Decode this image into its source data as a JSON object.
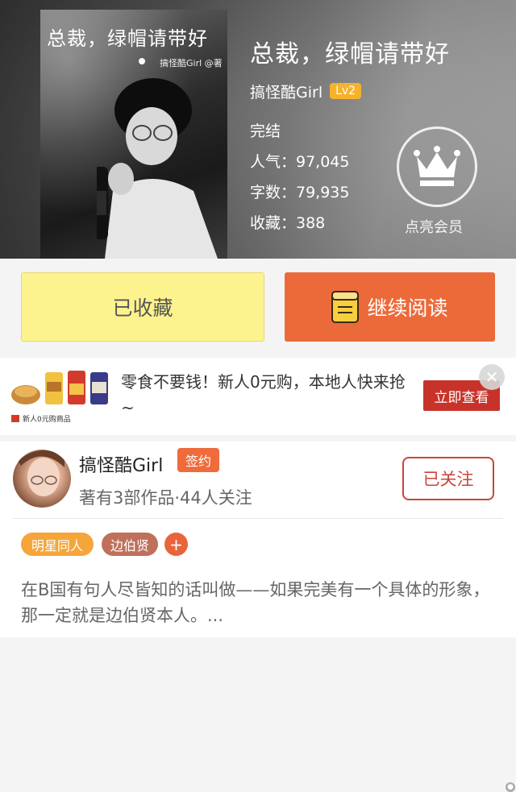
{
  "book": {
    "cover_title": "总裁，绿帽请带好",
    "cover_author": "搞怪酷Girl @著",
    "title": "总裁，绿帽请带好",
    "author": "搞怪酷Girl",
    "level": "Lv2",
    "status": "完结",
    "popularity": "人气：97,045",
    "word_count": "字数：79,935",
    "favorites": "收藏：388"
  },
  "vip": {
    "label": "点亮会员",
    "icon": "crown-icon"
  },
  "actions": {
    "favorited_label": "已收藏",
    "continue_label": "继续阅读",
    "continue_icon": "book-icon"
  },
  "ad": {
    "text": "零食不要钱！新人0元购，本地人快来抢~",
    "button_label": "立即查看",
    "image_caption": "新人0元购商品",
    "close_icon": "close-icon"
  },
  "author_card": {
    "name": "搞怪酷Girl",
    "badge": "签约",
    "meta": "著有3部作品·44人关注",
    "follow_label": "已关注",
    "tags": [
      "明星同人",
      "边伯贤"
    ],
    "add_tag": "+",
    "summary": "在B国有句人尽皆知的话叫做——如果完美有一个具体的形象，那一定就是边伯贤本人。..."
  },
  "colors": {
    "accent_orange": "#ec6a3a",
    "favorite_yellow": "#fdf38e",
    "level_badge": "#f6b22b",
    "follow_red": "#c9453b",
    "tag_orange": "#f5a53a",
    "tag_brown": "#c0705a"
  }
}
